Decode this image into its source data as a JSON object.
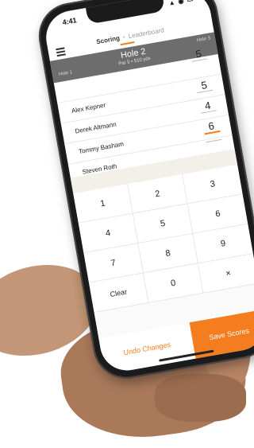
{
  "status": {
    "time": "4:41",
    "icons": "▲ ◉ ▭"
  },
  "tabs": {
    "scoring": "Scoring",
    "separator": "•",
    "leaderboard": "Leaderboard"
  },
  "hole": {
    "title": "Hole 2",
    "subtitle": "Par 5 • 510 yds",
    "prev": "Hole 1",
    "next": "Hole 3"
  },
  "players": [
    {
      "name": "",
      "score": "5"
    },
    {
      "name": "Alex Kepner",
      "score": "5"
    },
    {
      "name": "Derek Altmann",
      "score": "4"
    },
    {
      "name": "Tommy Basham",
      "score": "6"
    },
    {
      "name": "Steven Roth",
      "score": ""
    }
  ],
  "keypad": [
    "1",
    "2",
    "3",
    "4",
    "5",
    "6",
    "7",
    "8",
    "9",
    "Clear",
    "0",
    "×"
  ],
  "actions": {
    "undo": "Undo Changes",
    "save": "Save Scores"
  },
  "colors": {
    "accent": "#f47d20",
    "header": "#6d6d6d"
  }
}
